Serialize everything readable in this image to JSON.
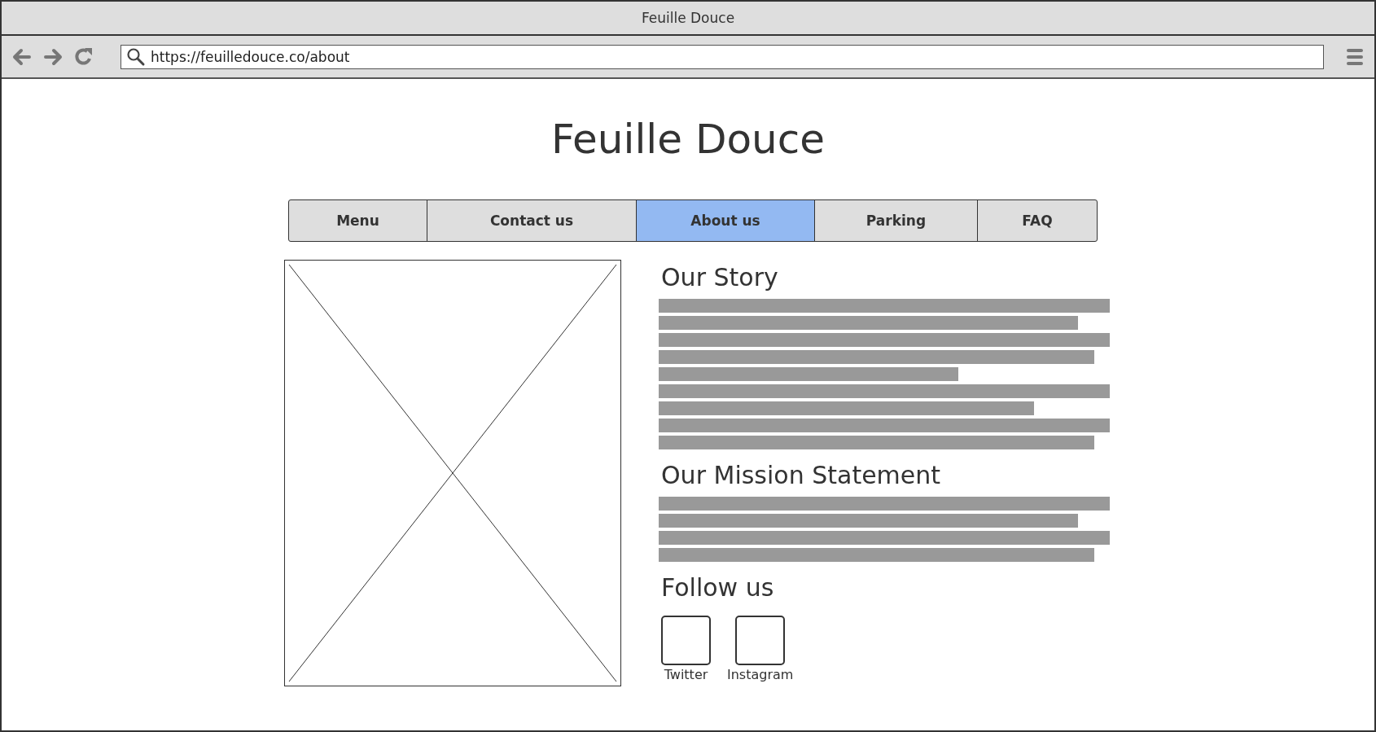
{
  "window": {
    "title": "Feuille Douce"
  },
  "toolbar": {
    "url": "https://feuilledouce.co/about"
  },
  "page": {
    "heading": "Feuille Douce",
    "nav": [
      {
        "label": "Menu",
        "selected": false
      },
      {
        "label": "Contact us",
        "selected": false
      },
      {
        "label": "About us",
        "selected": true
      },
      {
        "label": "Parking",
        "selected": false
      },
      {
        "label": "FAQ",
        "selected": false
      }
    ],
    "image": {
      "kind": "placeholder"
    },
    "sections": [
      {
        "heading": "Our Story",
        "kind": "lines"
      },
      {
        "heading": "Our Mission Statement",
        "kind": "lines"
      },
      {
        "heading": "Follow us",
        "kind": "social"
      }
    ],
    "social": [
      {
        "label": "Twitter"
      },
      {
        "label": "Instagram"
      }
    ]
  }
}
